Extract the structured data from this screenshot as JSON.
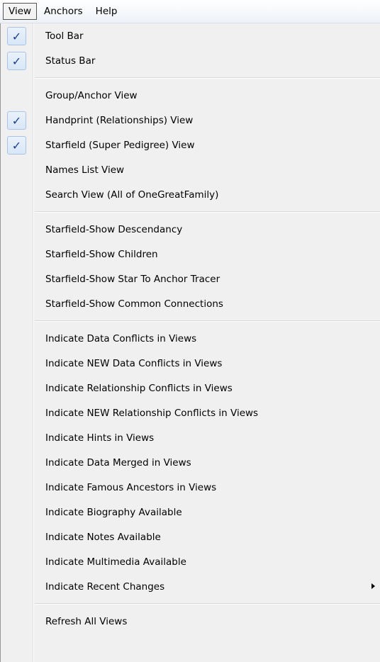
{
  "menubar": {
    "view": "View",
    "anchors": "Anchors",
    "help": "Help"
  },
  "menu": {
    "check_glyph": "✓",
    "sections": [
      {
        "items": [
          {
            "label": "Tool Bar",
            "checked": true
          },
          {
            "label": "Status Bar",
            "checked": true
          }
        ]
      },
      {
        "items": [
          {
            "label": "Group/Anchor View",
            "checked": false
          },
          {
            "label": "Handprint (Relationships) View",
            "checked": true
          },
          {
            "label": "Starfield (Super Pedigree) View",
            "checked": true
          },
          {
            "label": "Names List View",
            "checked": false
          },
          {
            "label": "Search View (All of OneGreatFamily)",
            "checked": false
          }
        ]
      },
      {
        "items": [
          {
            "label": "Starfield-Show Descendancy",
            "checked": false
          },
          {
            "label": "Starfield-Show Children",
            "checked": false
          },
          {
            "label": "Starfield-Show Star To Anchor Tracer",
            "checked": false
          },
          {
            "label": "Starfield-Show Common Connections",
            "checked": false
          }
        ]
      },
      {
        "items": [
          {
            "label": "Indicate Data Conflicts in Views",
            "checked": false
          },
          {
            "label": "Indicate NEW Data Conflicts in Views",
            "checked": false
          },
          {
            "label": "Indicate Relationship Conflicts in Views",
            "checked": false
          },
          {
            "label": "Indicate NEW Relationship Conflicts in Views",
            "checked": false
          },
          {
            "label": "Indicate Hints in Views",
            "checked": false
          },
          {
            "label": "Indicate Data Merged in Views",
            "checked": false
          },
          {
            "label": "Indicate Famous Ancestors in Views",
            "checked": false
          },
          {
            "label": "Indicate Biography Available",
            "checked": false
          },
          {
            "label": "Indicate Notes Available",
            "checked": false
          },
          {
            "label": "Indicate Multimedia Available",
            "checked": false
          },
          {
            "label": "Indicate Recent Changes",
            "checked": false,
            "submenu": true
          }
        ]
      },
      {
        "items": [
          {
            "label": "Refresh All Views",
            "checked": false
          }
        ]
      }
    ]
  }
}
